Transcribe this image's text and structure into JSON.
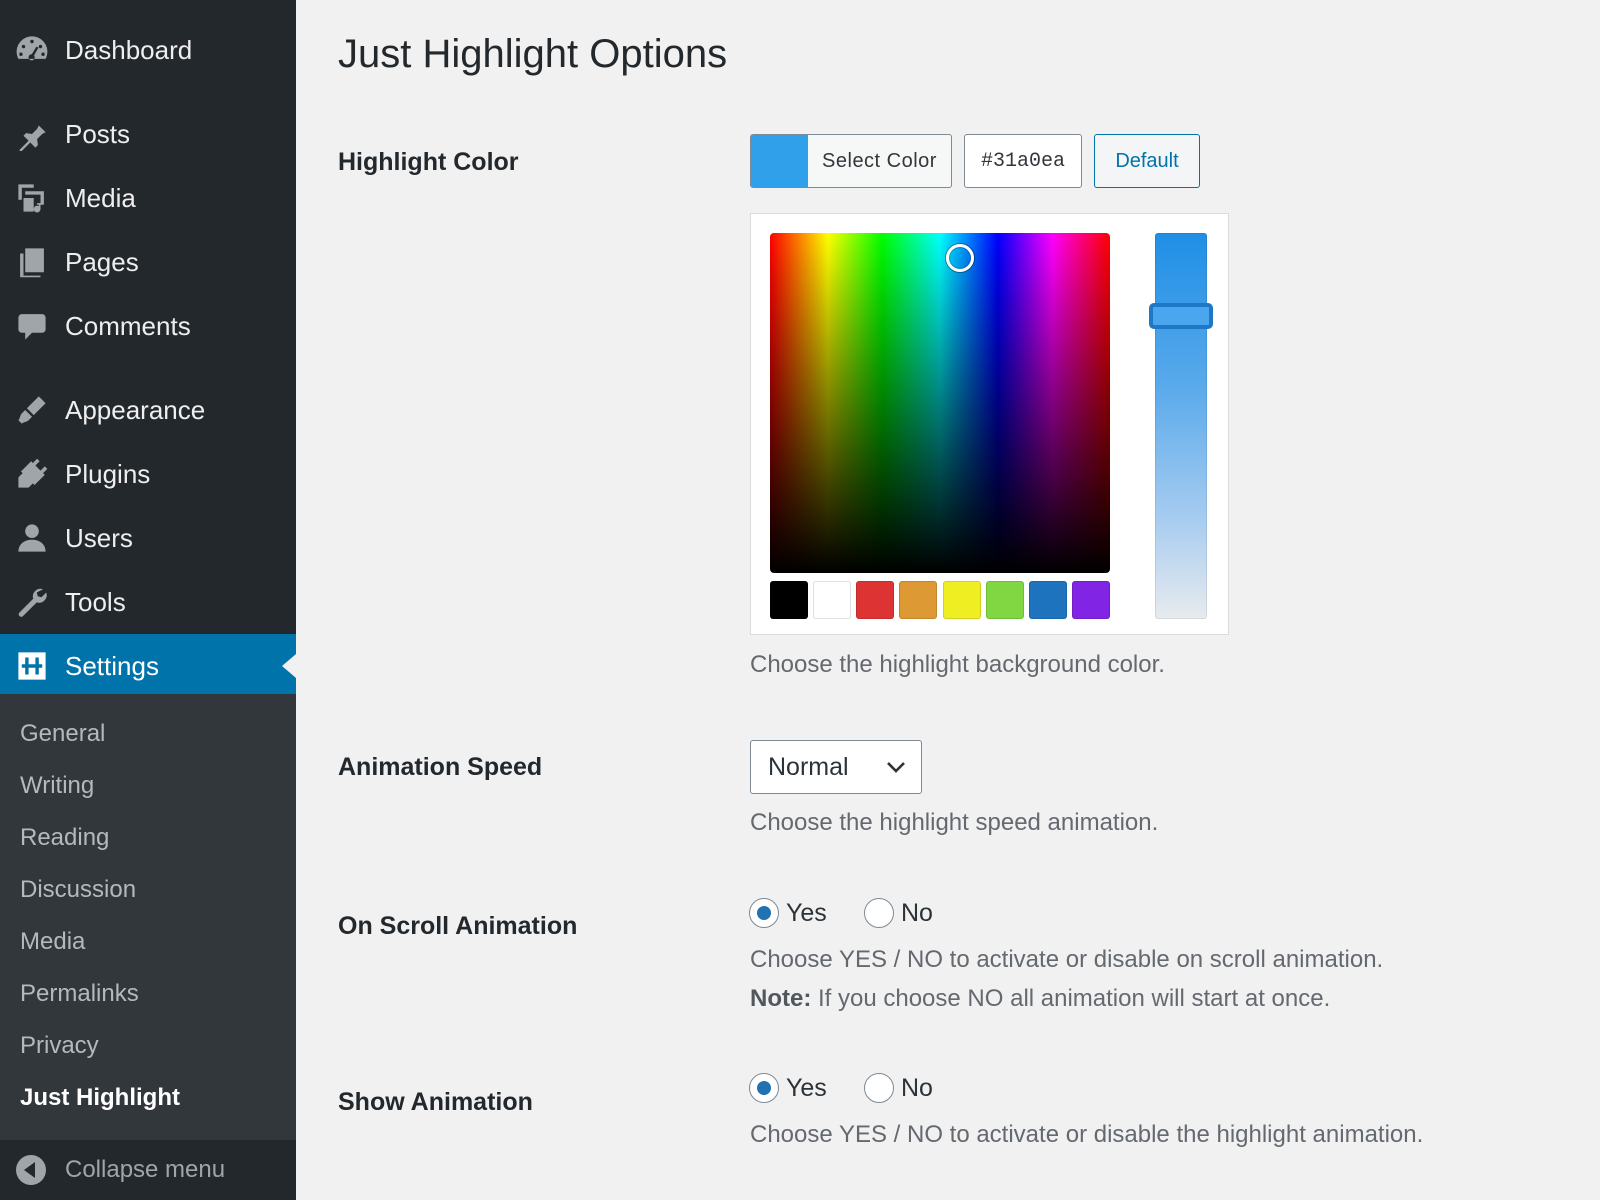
{
  "sidebar": {
    "items": [
      {
        "label": "Dashboard",
        "icon": "dashboard-icon"
      },
      {
        "label": "Posts",
        "icon": "pin-icon"
      },
      {
        "label": "Media",
        "icon": "media-icon"
      },
      {
        "label": "Pages",
        "icon": "pages-icon"
      },
      {
        "label": "Comments",
        "icon": "comment-icon"
      },
      {
        "label": "Appearance",
        "icon": "brush-icon"
      },
      {
        "label": "Plugins",
        "icon": "plug-icon"
      },
      {
        "label": "Users",
        "icon": "user-icon"
      },
      {
        "label": "Tools",
        "icon": "wrench-icon"
      },
      {
        "label": "Settings",
        "icon": "settings-icon",
        "active": true
      }
    ],
    "submenu": [
      "General",
      "Writing",
      "Reading",
      "Discussion",
      "Media",
      "Permalinks",
      "Privacy",
      "Just Highlight"
    ],
    "submenu_current": "Just Highlight",
    "collapse_label": "Collapse menu"
  },
  "main": {
    "title": "Just Highlight Options",
    "highlight_color": {
      "label": "Highlight Color",
      "select_label": "Select Color",
      "value": "#31a0ea",
      "default_label": "Default",
      "palette": [
        "#000000",
        "#ffffff",
        "#dd3333",
        "#dd9933",
        "#eeee22",
        "#81d742",
        "#1e73be",
        "#8224e3"
      ],
      "description": "Choose the highlight background color."
    },
    "animation_speed": {
      "label": "Animation Speed",
      "value": "Normal",
      "description": "Choose the highlight speed animation."
    },
    "on_scroll": {
      "label": "On Scroll Animation",
      "options": [
        "Yes",
        "No"
      ],
      "selected": "Yes",
      "description": "Choose YES / NO to activate or disable on scroll animation.",
      "note_label": "Note:",
      "note_text": " If you choose NO all animation will start at once."
    },
    "show_animation": {
      "label": "Show Animation",
      "options": [
        "Yes",
        "No"
      ],
      "selected": "Yes",
      "description": "Choose YES / NO to activate or disable the highlight animation."
    }
  },
  "colors": {
    "sidebar_bg": "#23282d",
    "submenu_bg": "#32373c",
    "accent": "#0073aa",
    "page_bg": "#f1f1f1"
  }
}
